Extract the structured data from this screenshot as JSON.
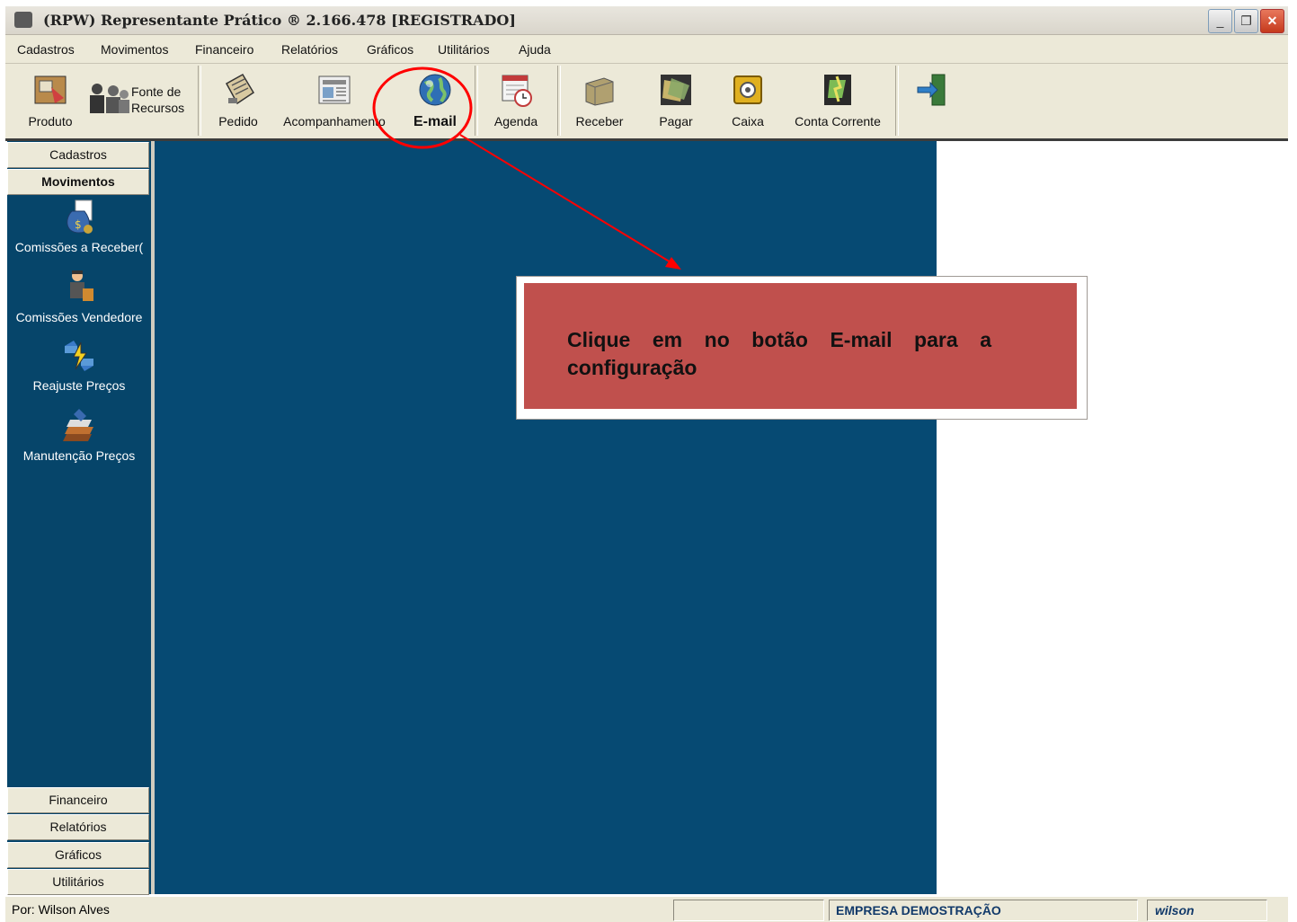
{
  "window": {
    "title": "(RPW) Representante Prático ® 2.166.478 [REGISTRADO]",
    "controls": [
      "minimize",
      "restore",
      "close"
    ]
  },
  "menubar": {
    "items": [
      "Cadastros",
      "Movimentos",
      "Financeiro",
      "Relatórios",
      "Gráficos",
      "Utilitários",
      "Ajuda"
    ]
  },
  "toolbar": {
    "buttons": [
      {
        "label": "Produto",
        "icon": "product-box-icon"
      },
      {
        "label": "Fonte de Recursos",
        "label_line1": "Fonte de",
        "label_line2": "Recursos",
        "icon": "people-icon"
      },
      {
        "label": "Pedido",
        "icon": "clipboard-icon"
      },
      {
        "label": "Acompanhamento",
        "icon": "newspaper-icon"
      },
      {
        "label": "E-mail",
        "icon": "globe-icon"
      },
      {
        "label": "Agenda",
        "icon": "calendar-clock-icon"
      },
      {
        "label": "Receber",
        "icon": "folders-icon"
      },
      {
        "label": "Pagar",
        "icon": "money-icon"
      },
      {
        "label": "Caixa",
        "icon": "safe-icon"
      },
      {
        "label": "Conta Corrente",
        "icon": "bank-account-icon"
      },
      {
        "label": "",
        "icon": "exit-door-icon"
      }
    ]
  },
  "sidebar": {
    "top_sections": [
      "Cadastros",
      "Movimentos"
    ],
    "active_section": "Movimentos",
    "items": [
      {
        "label": "Comissões a Receber(",
        "icon": "money-bag-icon"
      },
      {
        "label": "Comissões Vendedore",
        "icon": "salesman-icon"
      },
      {
        "label": "Reajuste Preços",
        "icon": "price-adjust-icon"
      },
      {
        "label": "Manutenção Preços",
        "icon": "books-icon"
      }
    ],
    "bottom_sections": [
      "Financeiro",
      "Relatórios",
      "Gráficos",
      "Utilitários"
    ]
  },
  "statusbar": {
    "author": "Por: Wilson Alves",
    "company": "EMPRESA DEMOSTRAÇÃO",
    "user": "wilson"
  },
  "annotation": {
    "text": "Clique em no botão E-mail para a configuração",
    "box_color": "#c0504d",
    "circle_color": "#ff0000",
    "arrow_color": "#ff0000"
  }
}
